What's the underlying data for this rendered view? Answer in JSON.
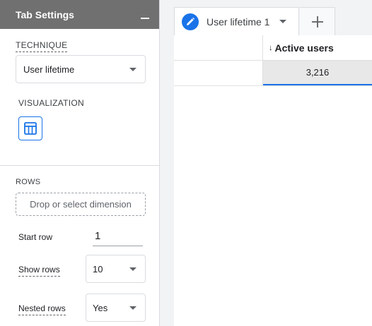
{
  "panel": {
    "title": "Tab Settings",
    "technique": {
      "label": "TECHNIQUE",
      "value": "User lifetime"
    },
    "visualization": {
      "label": "VISUALIZATION",
      "icon": "table-icon"
    },
    "rows": {
      "label": "ROWS",
      "drop_placeholder": "Drop or select dimension",
      "start_row": {
        "label": "Start row",
        "value": "1"
      },
      "show_rows": {
        "label": "Show rows",
        "value": "10"
      },
      "nested_rows": {
        "label": "Nested rows",
        "value": "Yes"
      }
    }
  },
  "canvas": {
    "tab": {
      "label": "User lifetime 1",
      "icon": "pencil-icon"
    },
    "add_tab_icon": "plus-icon",
    "table": {
      "metric_header": "Active users",
      "sort_icon": "↓",
      "rows": [
        {
          "dimension": "",
          "value": "3,216"
        }
      ]
    }
  },
  "colors": {
    "accent": "#1a73e8",
    "header_bg": "#707070"
  }
}
